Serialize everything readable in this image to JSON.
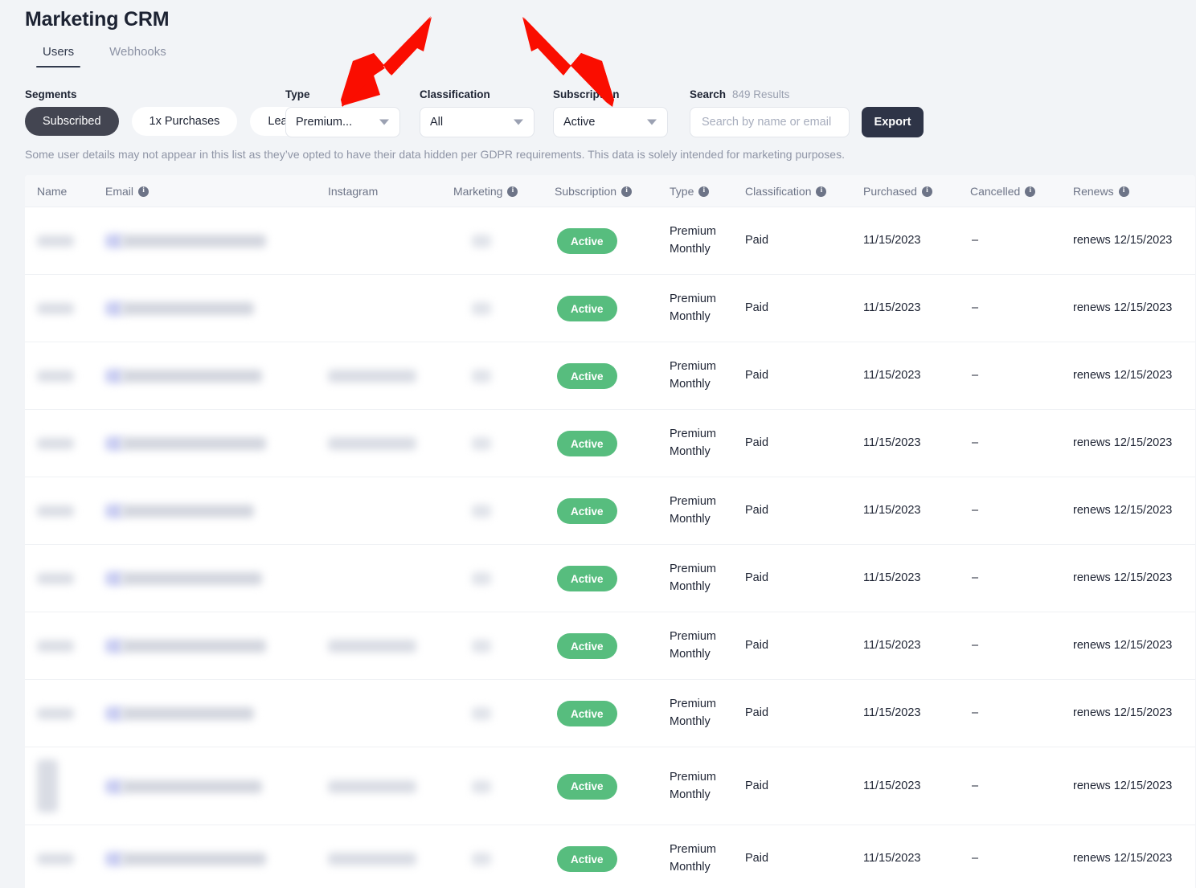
{
  "header": {
    "title": "Marketing CRM",
    "tabs": [
      {
        "label": "Users",
        "active": true
      },
      {
        "label": "Webhooks",
        "active": false
      }
    ]
  },
  "filters": {
    "segments": {
      "label": "Segments",
      "options": [
        {
          "label": "Subscribed",
          "selected": true
        },
        {
          "label": "1x Purchases",
          "selected": false
        },
        {
          "label": "Leads",
          "selected": false
        }
      ]
    },
    "type": {
      "label": "Type",
      "value": "Premium..."
    },
    "classification": {
      "label": "Classification",
      "value": "All"
    },
    "subscription": {
      "label": "Subscription",
      "value": "Active"
    },
    "search": {
      "label": "Search",
      "results_count": "849 Results",
      "placeholder": "Search by name or email",
      "value": ""
    },
    "export_label": "Export"
  },
  "notice": "Some user details may not appear in this list as they’ve opted to have their data hidden per GDPR requirements. This data is solely intended for marketing purposes.",
  "table": {
    "columns": [
      {
        "label": "Name",
        "info": false
      },
      {
        "label": "Email",
        "info": true
      },
      {
        "label": "Instagram",
        "info": false
      },
      {
        "label": "Marketing",
        "info": true
      },
      {
        "label": "Subscription",
        "info": true
      },
      {
        "label": "Type",
        "info": true
      },
      {
        "label": "Classification",
        "info": true
      },
      {
        "label": "Purchased",
        "info": true
      },
      {
        "label": "Cancelled",
        "info": true
      },
      {
        "label": "Renews",
        "info": true
      }
    ],
    "rows": [
      {
        "name": "",
        "email": "",
        "instagram": "",
        "marketing": "",
        "subscription": "Active",
        "type": "Premium Monthly",
        "classification": "Paid",
        "purchased": "11/15/2023",
        "cancelled": "–",
        "renews": "renews 12/15/2023",
        "redacted": true,
        "tall": false,
        "has_instagram": false
      },
      {
        "name": "",
        "email": "",
        "instagram": "",
        "marketing": "",
        "subscription": "Active",
        "type": "Premium Monthly",
        "classification": "Paid",
        "purchased": "11/15/2023",
        "cancelled": "–",
        "renews": "renews 12/15/2023",
        "redacted": true,
        "tall": false,
        "has_instagram": false
      },
      {
        "name": "",
        "email": "",
        "instagram": "",
        "marketing": "",
        "subscription": "Active",
        "type": "Premium Monthly",
        "classification": "Paid",
        "purchased": "11/15/2023",
        "cancelled": "–",
        "renews": "renews 12/15/2023",
        "redacted": true,
        "tall": false,
        "has_instagram": true
      },
      {
        "name": "",
        "email": "",
        "instagram": "",
        "marketing": "",
        "subscription": "Active",
        "type": "Premium Monthly",
        "classification": "Paid",
        "purchased": "11/15/2023",
        "cancelled": "–",
        "renews": "renews 12/15/2023",
        "redacted": true,
        "tall": false,
        "has_instagram": true
      },
      {
        "name": "",
        "email": "",
        "instagram": "",
        "marketing": "",
        "subscription": "Active",
        "type": "Premium Monthly",
        "classification": "Paid",
        "purchased": "11/15/2023",
        "cancelled": "–",
        "renews": "renews 12/15/2023",
        "redacted": true,
        "tall": false,
        "has_instagram": false
      },
      {
        "name": "",
        "email": "",
        "instagram": "",
        "marketing": "",
        "subscription": "Active",
        "type": "Premium Monthly",
        "classification": "Paid",
        "purchased": "11/15/2023",
        "cancelled": "–",
        "renews": "renews 12/15/2023",
        "redacted": true,
        "tall": false,
        "has_instagram": false
      },
      {
        "name": "",
        "email": "",
        "instagram": "",
        "marketing": "",
        "subscription": "Active",
        "type": "Premium Monthly",
        "classification": "Paid",
        "purchased": "11/15/2023",
        "cancelled": "–",
        "renews": "renews 12/15/2023",
        "redacted": true,
        "tall": false,
        "has_instagram": true
      },
      {
        "name": "",
        "email": "",
        "instagram": "",
        "marketing": "",
        "subscription": "Active",
        "type": "Premium Monthly",
        "classification": "Paid",
        "purchased": "11/15/2023",
        "cancelled": "–",
        "renews": "renews 12/15/2023",
        "redacted": true,
        "tall": false,
        "has_instagram": false
      },
      {
        "name": "",
        "email": "",
        "instagram": "",
        "marketing": "",
        "subscription": "Active",
        "type": "Premium Monthly",
        "classification": "Paid",
        "purchased": "11/15/2023",
        "cancelled": "–",
        "renews": "renews 12/15/2023",
        "redacted": true,
        "tall": true,
        "has_instagram": true
      },
      {
        "name": "",
        "email": "",
        "instagram": "",
        "marketing": "",
        "subscription": "Active",
        "type": "Premium Monthly",
        "classification": "Paid",
        "purchased": "11/15/2023",
        "cancelled": "–",
        "renews": "renews 12/15/2023",
        "redacted": true,
        "tall": false,
        "has_instagram": true
      }
    ]
  },
  "annotations": {
    "arrow_color": "#fa0d00",
    "arrows": [
      {
        "name": "arrow-pointing-to-type-filter",
        "target": "type"
      },
      {
        "name": "arrow-pointing-to-subscription-filter",
        "target": "subscription"
      }
    ]
  },
  "colors": {
    "background": "#f2f4f7",
    "surface": "#ffffff",
    "text": "#1d2333",
    "muted": "#8f95a6",
    "accent_dark": "#2e3447",
    "status_active": "#57bd7e"
  }
}
